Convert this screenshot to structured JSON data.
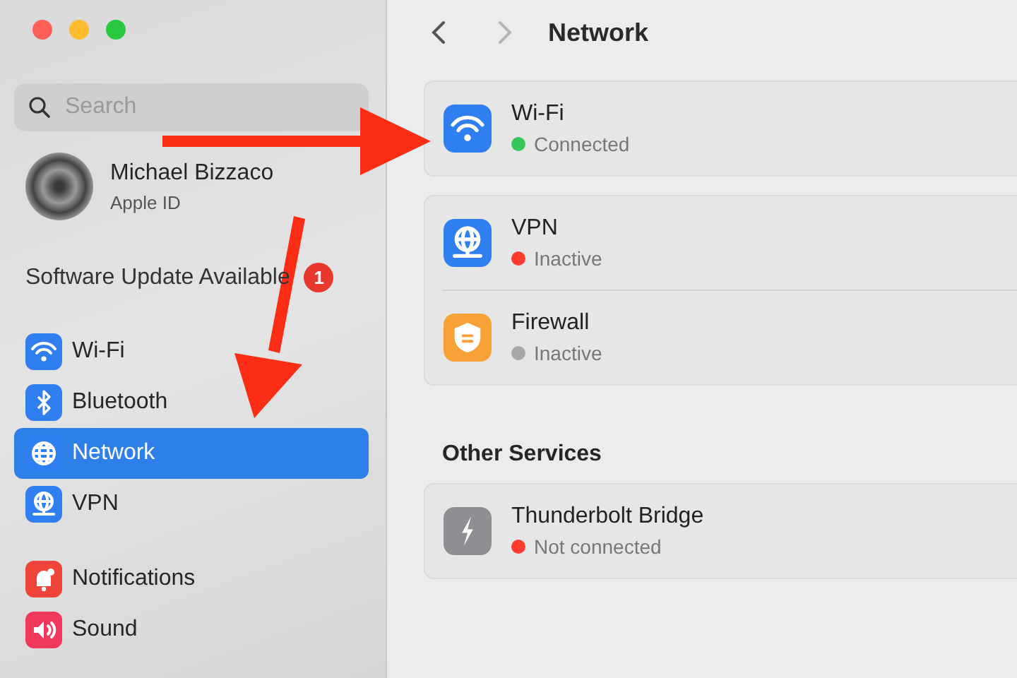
{
  "sidebar": {
    "search": {
      "placeholder": "Search"
    },
    "account": {
      "name": "Michael Bizzaco",
      "subtitle": "Apple ID"
    },
    "update": {
      "label": "Software Update Available",
      "badge": "1"
    },
    "groups": [
      {
        "items": [
          {
            "label": "Wi-Fi",
            "kind": "wifi",
            "selected": false
          },
          {
            "label": "Bluetooth",
            "kind": "bluetooth",
            "selected": false
          },
          {
            "label": "Network",
            "kind": "globe",
            "selected": true
          },
          {
            "label": "VPN",
            "kind": "vpn",
            "selected": false
          }
        ]
      },
      {
        "items": [
          {
            "label": "Notifications",
            "kind": "bell",
            "selected": false
          },
          {
            "label": "Sound",
            "kind": "speaker",
            "selected": false
          }
        ]
      }
    ]
  },
  "header": {
    "title": "Network"
  },
  "main": {
    "groups": [
      {
        "items": [
          {
            "name": "Wi-Fi",
            "kind": "wifi",
            "status": "Connected",
            "color": "#34c759"
          }
        ]
      },
      {
        "items": [
          {
            "name": "VPN",
            "kind": "vpn",
            "status": "Inactive",
            "color": "#ff3b30"
          },
          {
            "name": "Firewall",
            "kind": "shield",
            "status": "Inactive",
            "color": "#a8a8a8"
          }
        ]
      },
      {
        "heading": "Other Services",
        "items": [
          {
            "name": "Thunderbolt Bridge",
            "kind": "bolt",
            "status": "Not connected",
            "color": "#ff3b30"
          }
        ]
      }
    ]
  }
}
